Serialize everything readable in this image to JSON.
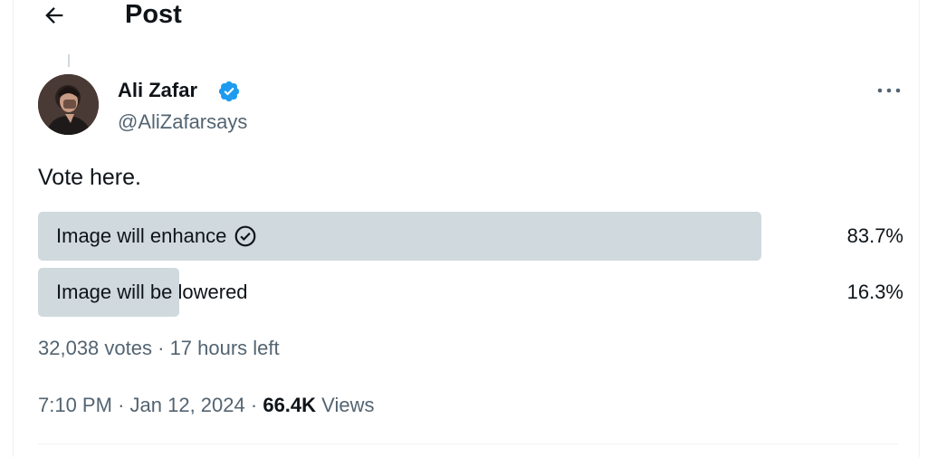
{
  "header": {
    "title": "Post",
    "back_icon": "arrow-left-icon"
  },
  "author": {
    "name": "Ali Zafar",
    "handle": "@AliZafarsays",
    "verified": true,
    "verified_color": "#1d9bf0"
  },
  "more_icon": "more-horizontal-icon",
  "tweet": {
    "text": "Vote here."
  },
  "poll": {
    "options": [
      {
        "label": "Image will enhance",
        "percent_label": "83.7%",
        "fraction": 0.837,
        "winner": true
      },
      {
        "label": "Image will be lowered",
        "percent_label": "16.3%",
        "fraction": 0.163,
        "winner": false
      }
    ],
    "votes": "32,038 votes",
    "separator": "·",
    "time_left": "17 hours left",
    "bar_color": "#cfd9de"
  },
  "meta": {
    "time": "7:10 PM",
    "separator": "·",
    "date": "Jan 12, 2024",
    "views_count": "66.4K",
    "views_label": "Views"
  }
}
